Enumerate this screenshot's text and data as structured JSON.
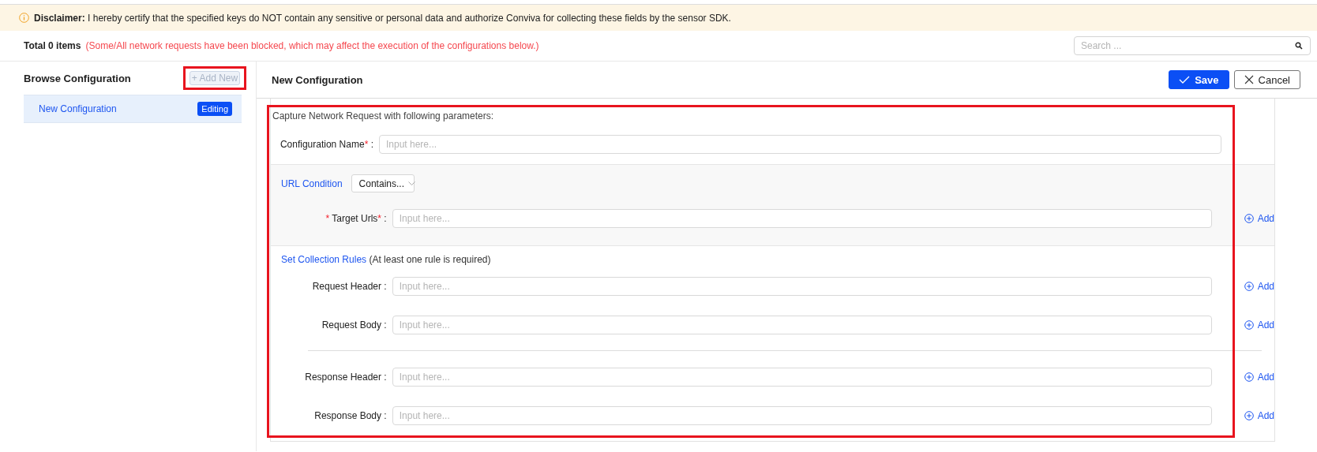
{
  "disclaimer": {
    "label": "Disclaimer:",
    "text": "I hereby certify that the specified keys do NOT contain any sensitive or personal data and authorize Conviva for collecting these fields by the sensor SDK."
  },
  "toolbar": {
    "total": "Total 0 items",
    "warning": "(Some/All network requests have been blocked, which may affect the execution of the configurations below.)",
    "search": {
      "placeholder": "Search ..."
    }
  },
  "sidebar": {
    "title": "Browse Configuration",
    "add_button": {
      "label": "+ Add New",
      "disabled": true
    },
    "items": [
      {
        "label": "New Configuration",
        "badge": "Editing",
        "selected": true
      }
    ]
  },
  "editor": {
    "title": "New Configuration",
    "buttons": [
      {
        "label": "Save",
        "kind": "primary"
      },
      {
        "label": "Cancel",
        "kind": "secondary"
      }
    ],
    "intro": "Capture Network Request with following parameters:",
    "name_field": {
      "label": "Configuration Name",
      "required_mark": "*",
      "colon": ":",
      "placeholder": "Input here..."
    },
    "url_condition": {
      "label": "URL Condition",
      "select": "Contains...",
      "fields": [
        {
          "label": "Target Urls",
          "prefix_mark": "*",
          "required_mark": "*",
          "colon": ":",
          "placeholder": "Input here...",
          "action": "Add"
        }
      ]
    },
    "rules": {
      "label": "Set Collection Rules",
      "note": "(At least one rule is required)",
      "groups": [
        [
          {
            "label": "Request Header",
            "colon": ":",
            "placeholder": "Input here...",
            "action": "Add"
          },
          {
            "label": "Request Body",
            "colon": ":",
            "placeholder": "Input here...",
            "action": "Add"
          }
        ],
        [
          {
            "label": "Response Header",
            "colon": ":",
            "placeholder": "Input here...",
            "action": "Add"
          },
          {
            "label": "Response Body",
            "colon": ":",
            "placeholder": "Input here...",
            "action": "Add"
          }
        ]
      ]
    }
  }
}
